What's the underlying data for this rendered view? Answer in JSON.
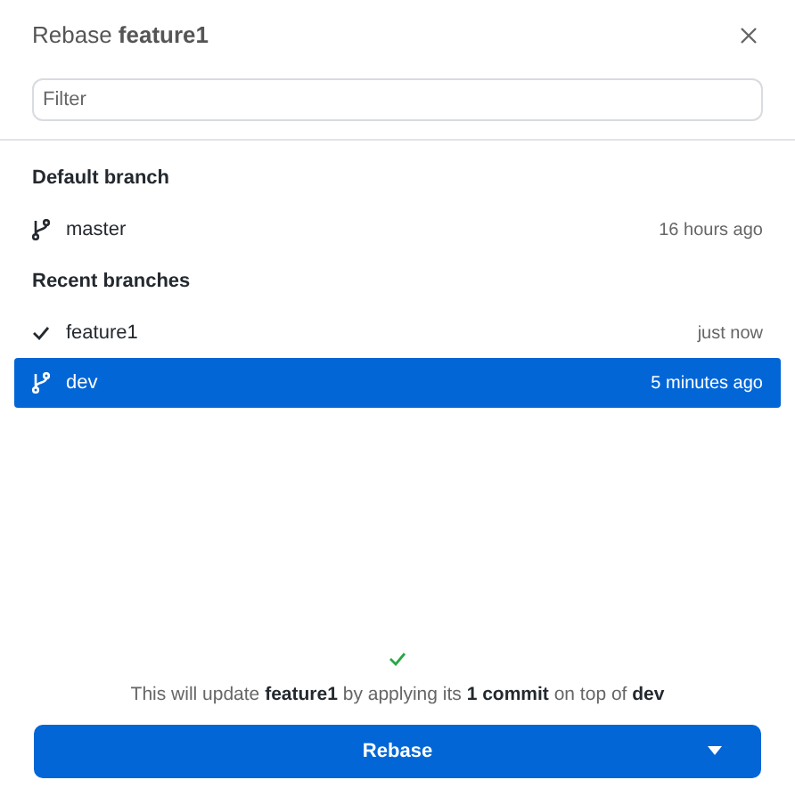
{
  "dialog": {
    "title": "Rebase **feature1**"
  },
  "filter": {
    "placeholder": "Filter"
  },
  "groups": [
    {
      "heading": "Default branch",
      "branches": [
        {
          "name": "master",
          "time": "16 hours ago",
          "current": false,
          "selected": false
        }
      ]
    },
    {
      "heading": "Recent branches",
      "branches": [
        {
          "name": "feature1",
          "time": "just now",
          "current": true,
          "selected": false
        },
        {
          "name": "dev",
          "time": "5 minutes ago",
          "current": false,
          "selected": true
        }
      ]
    }
  ],
  "summary": "This will update **feature1** by applying its **1 commit** on top of **dev**",
  "summary_ok": true,
  "button": {
    "label": "Rebase"
  }
}
